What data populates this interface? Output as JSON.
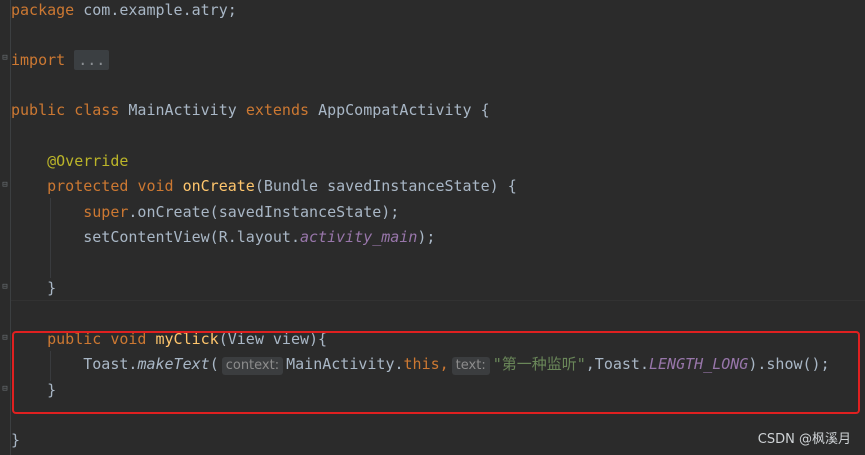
{
  "code": {
    "package_kw": "package",
    "package_name": " com.example.atry;",
    "import_kw": "import",
    "import_fold": "...",
    "l3_public": "public",
    "l3_class": "class",
    "l3_name": "MainActivity",
    "l3_extends": "extends",
    "l3_super": "AppCompatActivity {",
    "override": "@Override",
    "l5_protected": "protected",
    "l5_void": "void",
    "l5_method": "onCreate",
    "l5_params": "(Bundle savedInstanceState) {",
    "l6_super": "super",
    "l6_rest": ".onCreate(savedInstanceState);",
    "l7_pre": "setContentView(R.layout.",
    "l7_field": "activity_main",
    "l7_post": ");",
    "close_brace_1": "}",
    "l9_public": "public",
    "l9_void": "void",
    "l9_method": "myClick",
    "l9_params": "(View view){",
    "l10_toast": "Toast.",
    "l10_make": "makeText",
    "l10_open": "(",
    "hint_context": "context:",
    "l10_main": "MainActivity.",
    "l10_this": "this",
    "l10_comma": ",",
    "hint_text": "text:",
    "l10_string": "\"第一种监听\"",
    "l10_toast2": ",Toast.",
    "l10_const": "LENGTH_LONG",
    "l10_show": ").show();",
    "close_brace_2": "}",
    "close_brace_3": "}"
  },
  "watermark": "CSDN @枫溪月",
  "colors": {
    "background": "#2b2b2b",
    "keyword": "#cc7832",
    "method": "#ffc66d",
    "annotation": "#bbb529",
    "string": "#6a8759",
    "field": "#9876aa",
    "highlight": "#e02020"
  }
}
